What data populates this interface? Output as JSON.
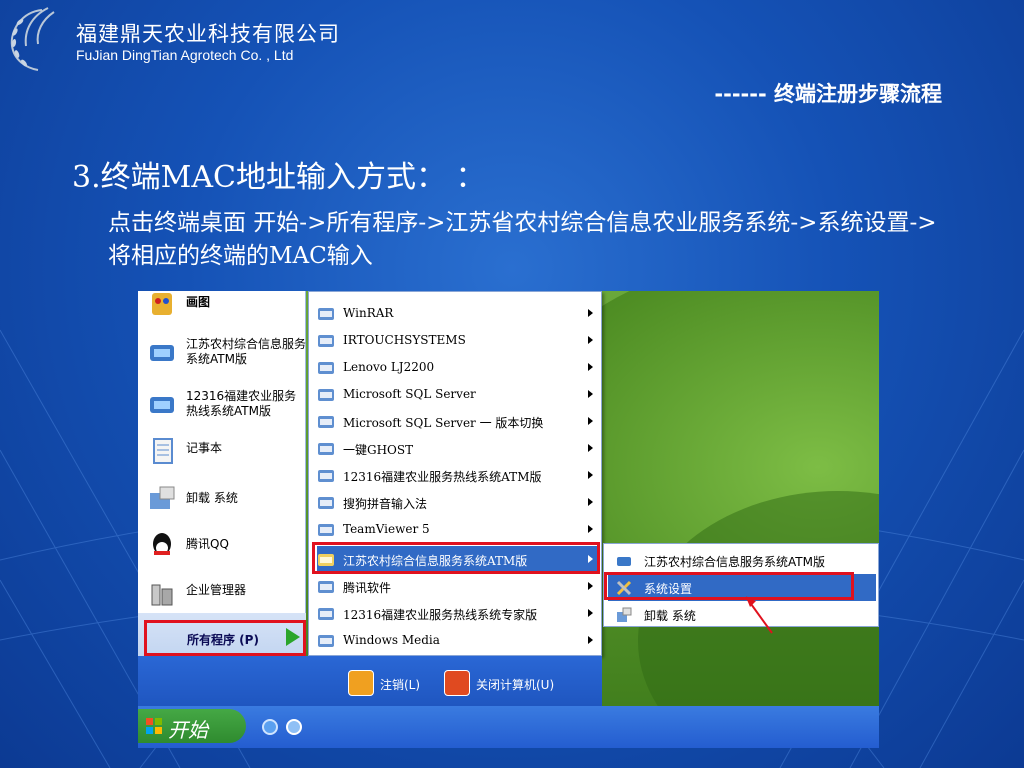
{
  "header": {
    "company_cn": "福建鼎天农业科技有限公司",
    "company_en": "FuJian DingTian Agrotech Co. , Ltd",
    "section_title": "------ 终端注册步骤流程"
  },
  "content": {
    "heading": "3.终端MAC地址输入方式：    ：",
    "description": "点击终端桌面  开始->所有程序->江苏省农村综合信息农业服务系统->系统设置-> 将相应的终端的MAC输入"
  },
  "screenshot": {
    "left_menu": [
      {
        "label": "画图",
        "icon": "paint-icon"
      },
      {
        "label": "江苏农村综合信息服务系统ATM版",
        "icon": "app-icon"
      },
      {
        "label": "12316福建农业服务热线系统ATM版",
        "icon": "app-icon"
      },
      {
        "label": "记事本",
        "icon": "notepad-icon"
      },
      {
        "label": "卸载 系统",
        "icon": "uninstall-icon"
      },
      {
        "label": "腾讯QQ",
        "icon": "qq-icon"
      },
      {
        "label": "企业管理器",
        "icon": "manager-icon"
      }
    ],
    "all_programs": "所有程序 (P)",
    "programs": [
      {
        "label": "WinRAR"
      },
      {
        "label": "IRTOUCHSYSTEMS"
      },
      {
        "label": "Lenovo LJ2200"
      },
      {
        "label": "Microsoft SQL Server"
      },
      {
        "label": "Microsoft SQL Server 一 版本切换"
      },
      {
        "label": "一键GHOST"
      },
      {
        "label": "12316福建农业服务热线系统ATM版"
      },
      {
        "label": "搜狗拼音输入法"
      },
      {
        "label": "TeamViewer 5"
      },
      {
        "label": "江苏农村综合信息服务系统ATM版"
      },
      {
        "label": "腾讯软件"
      },
      {
        "label": "12316福建农业服务热线系统专家版"
      },
      {
        "label": "Windows Media"
      }
    ],
    "submenu": [
      {
        "label": "江苏农村综合信息服务系统ATM版"
      },
      {
        "label": "系统设置"
      },
      {
        "label": "卸载 系统"
      }
    ],
    "logoff": "注销(L)",
    "shutdown": "关闭计算机(U)",
    "start": "开始",
    "colors": {
      "red_box": "#e0111e",
      "highlight": "#316ac5",
      "slide_bg": "#1552b6"
    }
  }
}
